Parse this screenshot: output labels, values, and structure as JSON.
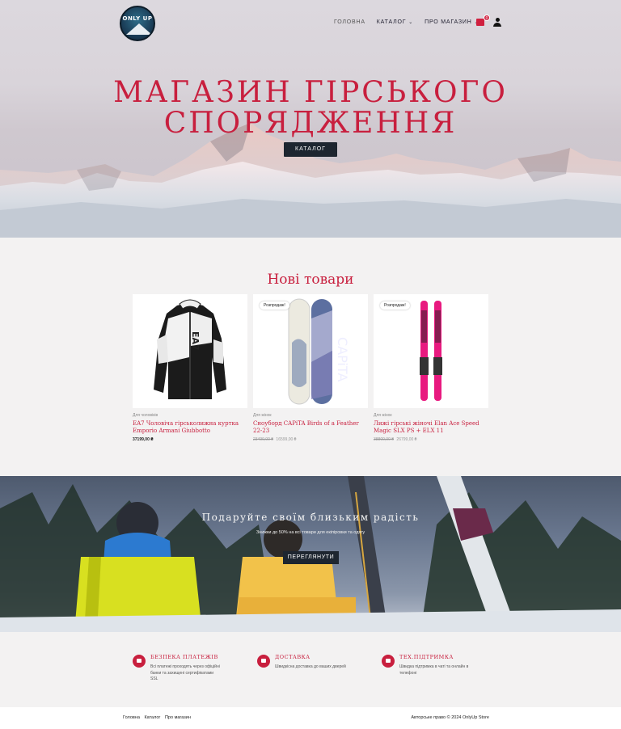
{
  "header": {
    "logo_text": "ONLY UP",
    "nav": [
      {
        "label": "ГОЛОВНА"
      },
      {
        "label": "КАТАЛОГ"
      },
      {
        "label": "ПРО МАГАЗИН"
      }
    ],
    "cart_count": "0"
  },
  "hero": {
    "title_line1": "МАГАЗИН ГІРСЬКОГО",
    "title_line2": "СПОРЯДЖЕННЯ",
    "button_label": "КАТАЛОГ"
  },
  "new_products": {
    "title": "Нові товари",
    "items": [
      {
        "badge": "",
        "category": "Для чоловіків",
        "name": "EA7 Чоловіча гірськолижна куртка Emporio Armani Giubbotto",
        "old_price": "",
        "price": "37199,00 ₴"
      },
      {
        "badge": "Розпродаж!",
        "category": "Для жінок",
        "name": "Сноуборд CAPiTA Birds of a Feather 22-23",
        "old_price": "23499,00 ₴",
        "price": "16599,00 ₴"
      },
      {
        "badge": "Розпродаж!",
        "category": "Для жінок",
        "name": "Лижі гірські жіночі Elan Ace Speed Magic SLX PS + ELX 11",
        "old_price": "38800,00 ₴",
        "price": "26799,00 ₴"
      }
    ]
  },
  "promo": {
    "title": "Подаруйте своїм близьким радість",
    "subtitle": "Знижки до 50% на всі товари для екіпіровки та одягу",
    "button_label": "ПЕРЕГЛЯНУТИ"
  },
  "features": [
    {
      "title": "БЕЗПЕКА ПЛАТЕЖІВ",
      "text": "Всі платежі проходять через офіційні банки та захищені сертифікатами SSL"
    },
    {
      "title": "ДОСТАВКА",
      "text": "Швидкісна доставка до ваших дверей"
    },
    {
      "title": "ТЕХ.ПІДТРИМКА",
      "text": "Швидка підтримка в чаті та онлайн в телефоні"
    }
  ],
  "footer": {
    "links": [
      "Головна",
      "Каталог",
      "Про магазин"
    ],
    "copyright": "Авторське право © 2024 OnlyUp Store"
  },
  "colors": {
    "accent": "#c81f3e",
    "dark_button": "#1e2630",
    "page_bg": "#f3f2f2"
  }
}
